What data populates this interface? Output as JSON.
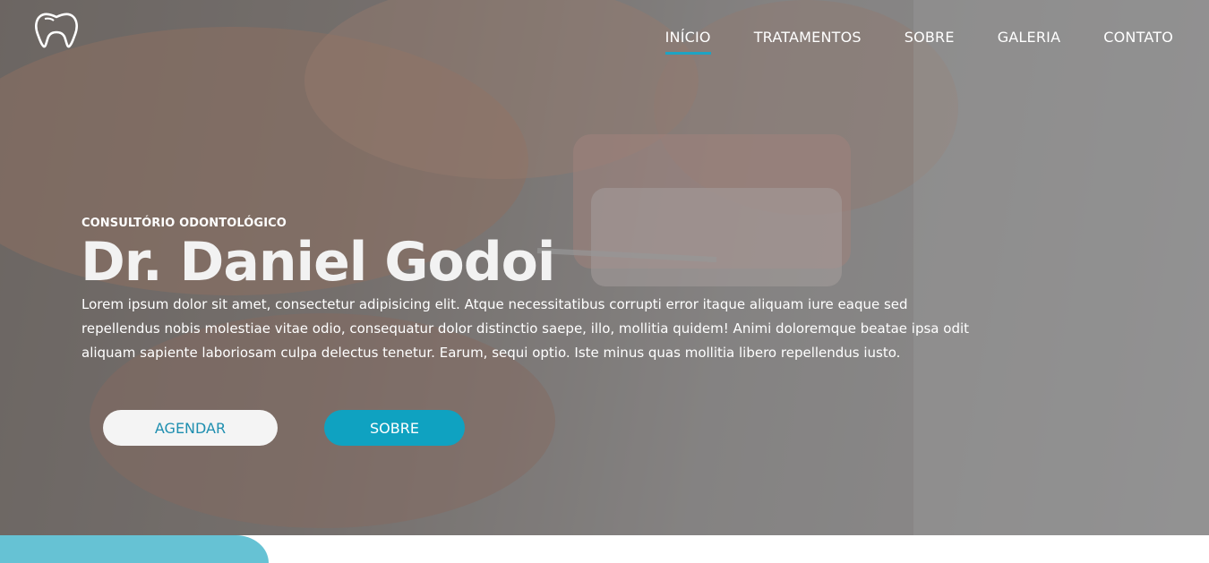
{
  "colors": {
    "accent": "#1ea3c3",
    "button_teal": "#0fa2c1",
    "button_light": "#f4f4f4",
    "bottom_shape": "#66c2d4"
  },
  "logo": {
    "icon": "tooth-icon"
  },
  "nav": {
    "items": [
      {
        "label": "INÍCIO",
        "active": true
      },
      {
        "label": "TRATAMENTOS",
        "active": false
      },
      {
        "label": "SOBRE",
        "active": false
      },
      {
        "label": "GALERIA",
        "active": false
      },
      {
        "label": "CONTATO",
        "active": false
      }
    ]
  },
  "hero": {
    "eyebrow": "CONSULTÓRIO ODONTOLÓGICO",
    "title": "Dr. Daniel Godoi",
    "description": "Lorem ipsum dolor sit amet, consectetur adipisicing elit. Atque necessitatibus corrupti error itaque aliquam iure eaque sed repellendus nobis molestiae vitae odio, consequatur dolor distinctio saepe, illo, mollitia quidem! Animi doloremque beatae ipsa odit aliquam sapiente laboriosam culpa delectus tenetur. Earum, sequi optio. Iste minus quas mollitia libero repellendus iusto.",
    "buttons": {
      "primary": "AGENDAR",
      "secondary": "SOBRE"
    }
  }
}
